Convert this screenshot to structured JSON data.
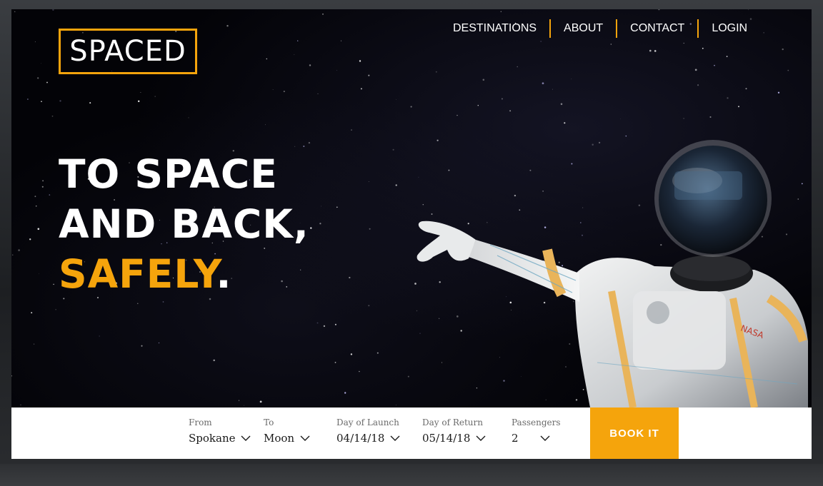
{
  "brand": {
    "logo_text": "SPACED",
    "accent_color": "#f5a40c"
  },
  "nav": {
    "items": [
      "DESTINATIONS",
      "ABOUT",
      "CONTACT",
      "LOGIN"
    ]
  },
  "hero": {
    "line1": "TO SPACE",
    "line2": "AND BACK,",
    "line3_accent": "SAFELY",
    "line3_tail": "."
  },
  "booking": {
    "from": {
      "label": "From",
      "value": "Spokane"
    },
    "to": {
      "label": "To",
      "value": "Moon"
    },
    "launch": {
      "label": "Day of Launch",
      "value": "04/14/18"
    },
    "return": {
      "label": "Day of Return",
      "value": "05/14/18"
    },
    "passengers": {
      "label": "Passengers",
      "value": "2"
    },
    "cta": "BOOK IT"
  },
  "icons": {
    "dropdown": "chevron-down-icon",
    "hero_image": "astronaut-image",
    "suit_patch": "NASA"
  }
}
